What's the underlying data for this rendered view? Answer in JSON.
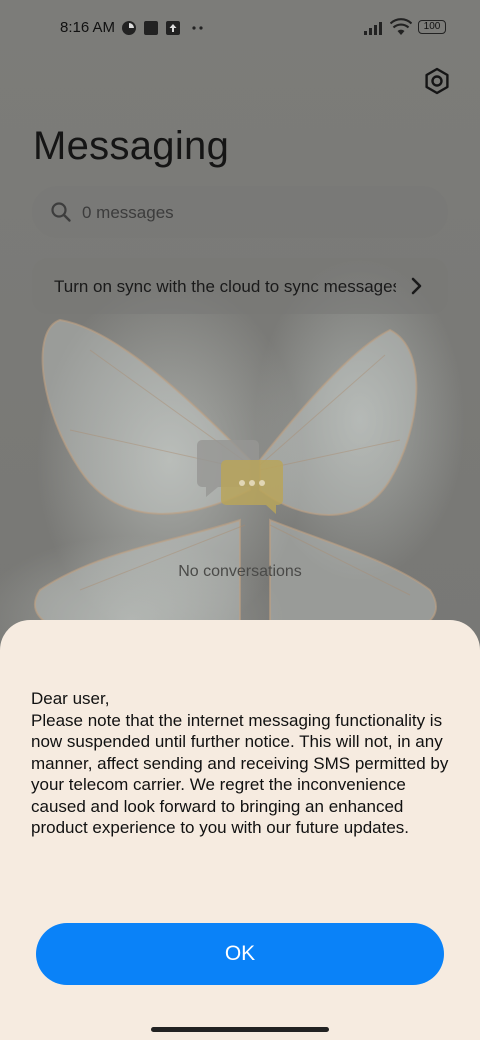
{
  "status_bar": {
    "time": "8:16 AM",
    "battery": "100",
    "icons": [
      "notification-icon",
      "square-app-icon",
      "upload-icon",
      "more-dots-icon",
      "signal-icon",
      "wifi-icon",
      "battery-icon"
    ]
  },
  "header": {
    "title": "Messaging",
    "settings_icon": "gear-icon"
  },
  "search": {
    "placeholder": "0 messages",
    "icon": "search-icon"
  },
  "sync_banner": {
    "text": "Turn on sync with the cloud to sync messages",
    "icon": "chevron-right-icon"
  },
  "empty_state": {
    "icon": "chat-bubbles-icon",
    "text": "No conversations"
  },
  "dialog": {
    "paragraphs": [
      "Dear user,",
      "Please note that the internet messaging functionality is now suspended until further notice. This will not, in any manner, affect sending and receiving SMS permitted by your telecom carrier. We regret the inconvenience caused and look forward to bringing an enhanced product experience to you with our future updates."
    ],
    "ok_label": "OK"
  },
  "colors": {
    "accent": "#0a82f8",
    "sheet_background": "#f6ebe0",
    "overlay": "#7a7a77"
  }
}
